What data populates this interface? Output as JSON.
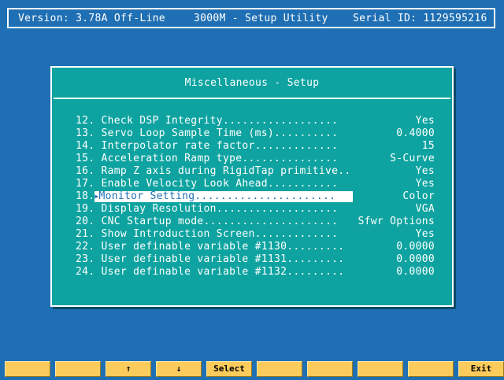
{
  "header": {
    "version": "Version: 3.78A Off-Line",
    "title": "3000M - Setup Utility",
    "serial": "Serial ID: 1129595216"
  },
  "panel": {
    "title": "Miscellaneous - Setup",
    "rows": [
      {
        "num": "12.",
        "label": "Check DSP Integrity..................",
        "value": "Yes"
      },
      {
        "num": "13.",
        "label": "Servo Loop Sample Time (ms)..........",
        "value": "0.4000"
      },
      {
        "num": "14.",
        "label": "Interpolator rate factor.............",
        "value": "15"
      },
      {
        "num": "15.",
        "label": "Acceleration Ramp type...............",
        "value": "S-Curve"
      },
      {
        "num": "16.",
        "label": "Ramp Z axis during RigidTap primitive..",
        "value": "Yes"
      },
      {
        "num": "17.",
        "label": "Enable Velocity Look Ahead...........",
        "value": "Yes"
      },
      {
        "num": "18.",
        "label": "Monitor Setting......................",
        "value": "Color",
        "selected": true
      },
      {
        "num": "19.",
        "label": "Display Resolution...................",
        "value": "VGA"
      },
      {
        "num": "20.",
        "label": "CNC Startup mode.....................",
        "value": "Sfwr Options"
      },
      {
        "num": "21.",
        "label": "Show Introduction Screen.............",
        "value": "Yes"
      },
      {
        "num": "22.",
        "label": "User definable variable #1130.........",
        "value": "0.0000"
      },
      {
        "num": "23.",
        "label": "User definable variable #1131.........",
        "value": "0.0000"
      },
      {
        "num": "24.",
        "label": "User definable variable #1132.........",
        "value": "0.0000"
      }
    ]
  },
  "fkeys": [
    "",
    "",
    "↑",
    "↓",
    "Select",
    "",
    "",
    "",
    "",
    "Exit"
  ],
  "colors": {
    "background": "#1f6fb4",
    "panel": "#0ea3a0",
    "fkey": "#fbcc5c",
    "highlight": "#ffffff"
  }
}
